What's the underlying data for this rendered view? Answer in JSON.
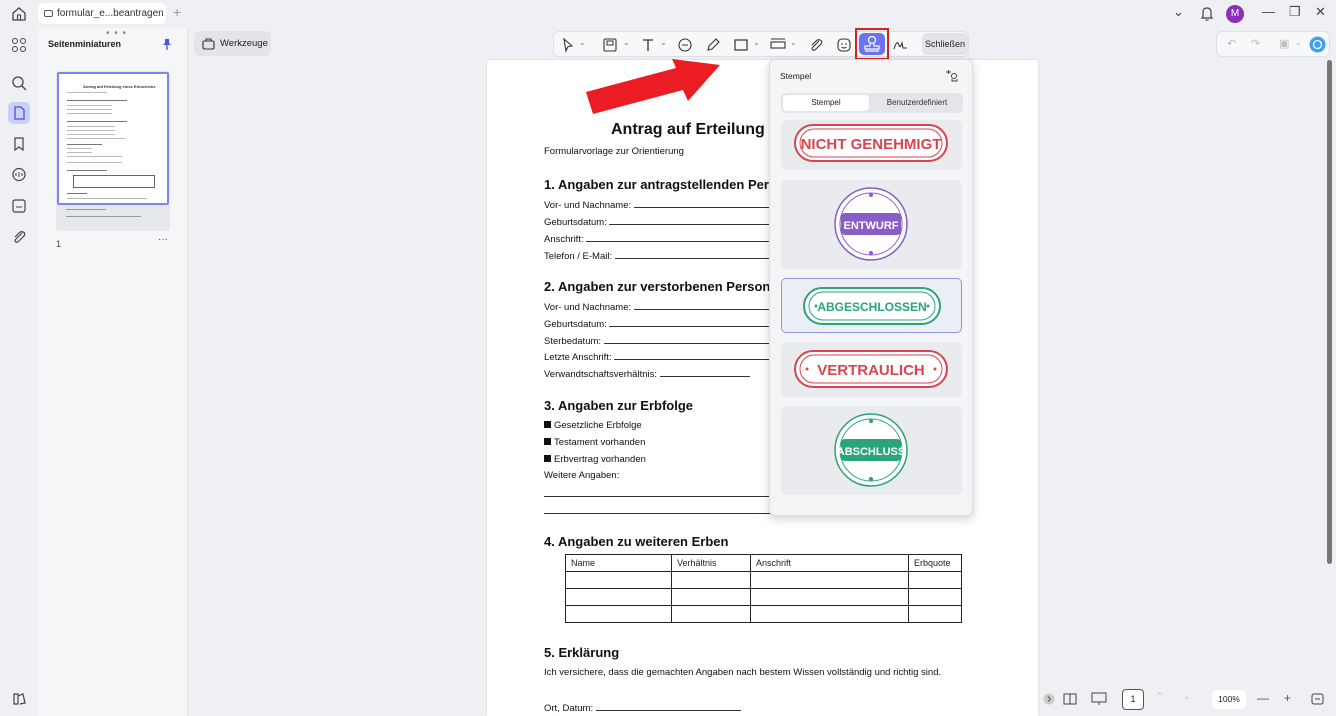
{
  "window": {
    "tab_label": "formular_e...beantragen",
    "tab_add": "+",
    "avatar_initial": "M",
    "notification_icon": "bell-icon",
    "controls": {
      "chevron": "⌄",
      "minimize": "—",
      "restore": "❐",
      "close": "✕"
    }
  },
  "sidebar": {
    "title": "Seitenminiaturen",
    "dots": "• • •",
    "page_number": "1",
    "more": "···",
    "thumbnail_title": "Antrag auf Erteilung eines Erbscheins"
  },
  "toolbar": {
    "tools_label": "Werkzeuge",
    "close_label": "Schließen",
    "accent": "#6a74f0",
    "highlight": "#e02020"
  },
  "document": {
    "title": "Antrag auf Erteilung",
    "subtitle": "Formularvorlage zur Orientierung",
    "section1": {
      "heading": "1. Angaben zur antragstellenden Per",
      "fields": [
        "Vor- und Nachname:",
        "Geburtsdatum:",
        "Anschrift:",
        "Telefon / E-Mail:"
      ]
    },
    "section2": {
      "heading": "2. Angaben zur verstorbenen Person",
      "fields": [
        "Vor- und Nachname:",
        "Geburtsdatum:",
        "Sterbedatum:",
        "Letzte Anschrift:",
        "Verwandtschaftsverhältnis:"
      ]
    },
    "section3": {
      "heading": "3. Angaben zur Erbfolge",
      "options": [
        "Gesetzliche Erbfolge",
        "Testament vorhanden",
        "Erbvertrag vorhanden"
      ],
      "more": "Weitere Angaben:"
    },
    "section4": {
      "heading": "4. Angaben zu weiteren Erben",
      "columns": [
        "Name",
        "Verhältnis",
        "Anschrift",
        "Erbquote"
      ]
    },
    "section5": {
      "heading": "5. Erklärung",
      "text": "Ich versichere, dass die gemachten Angaben nach bestem Wissen vollständig und richtig sind.",
      "place_date": "Ort, Datum:"
    }
  },
  "stamp_panel": {
    "title": "Stempel",
    "tab_active": "Stempel",
    "tab_custom": "Benutzerdefiniert",
    "stamps": [
      {
        "text": "NICHT GENEHMIGT",
        "color": "#d9454f"
      },
      {
        "text": "ENTWURF",
        "color": "#8a5cc7"
      },
      {
        "text": "ABGESCHLOSSEN",
        "color": "#2aa478"
      },
      {
        "text": "VERTRAULICH",
        "color": "#d9454f"
      },
      {
        "text": "ABSCHLUSS",
        "color": "#2aa478"
      }
    ]
  },
  "statusbar": {
    "page": "1",
    "zoom": "100%",
    "zoom_out": "—",
    "zoom_in": "+"
  }
}
